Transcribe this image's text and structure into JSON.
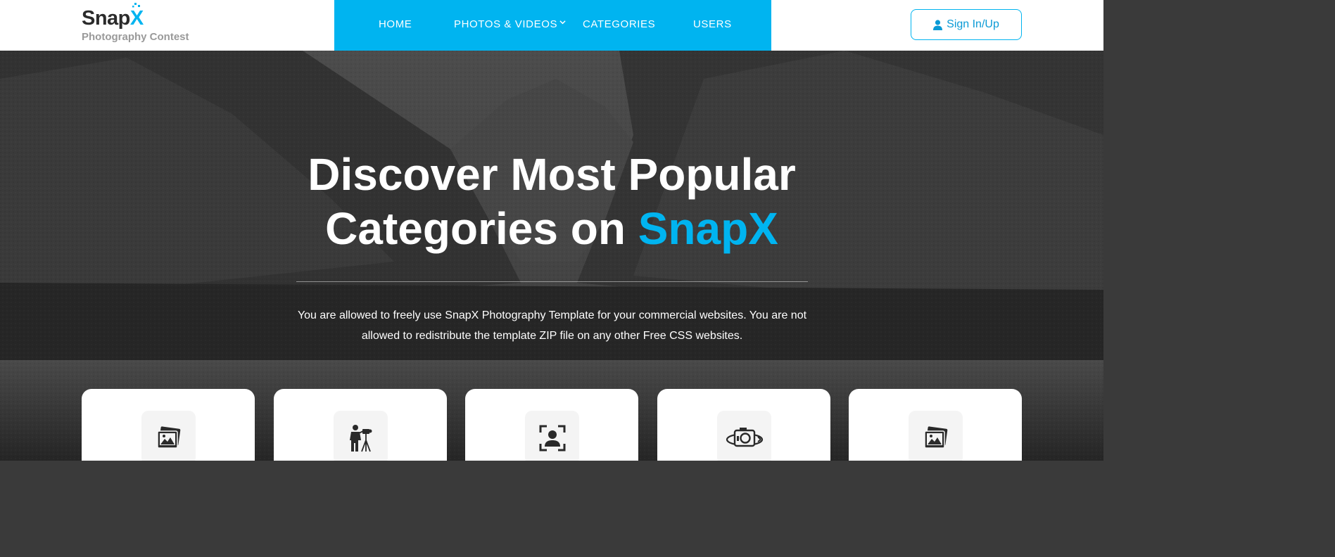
{
  "brand": {
    "name_main": "Snap",
    "name_accent": "X",
    "tagline": "Photography Contest"
  },
  "nav": {
    "items": [
      {
        "label": "HOME"
      },
      {
        "label": "PHOTOS & VIDEOS"
      },
      {
        "label": "CATEGORIES"
      },
      {
        "label": "USERS"
      }
    ],
    "signin_label": "Sign In/Up"
  },
  "hero": {
    "title_line1": "Discover Most Popular",
    "title_line2_prefix": "Categories on ",
    "title_line2_accent": "SnapX",
    "description_line1": "You are allowed to freely use SnapX Photography Template for your commercial websites. You are not",
    "description_line2": "allowed to redistribute the template ZIP file on any other Free CSS websites."
  },
  "cards": [
    {
      "icon": "photo-gallery-icon"
    },
    {
      "icon": "photographer-tripod-icon"
    },
    {
      "icon": "portrait-focus-icon"
    },
    {
      "icon": "camera-360-icon"
    },
    {
      "icon": "photo-gallery-icon"
    }
  ],
  "colors": {
    "accent": "#00b4f0",
    "header_bg": "#ffffff",
    "nav_bg": "#00b4f0",
    "card_bg": "#ffffff",
    "icon_tile_bg": "#f4f4f4"
  }
}
